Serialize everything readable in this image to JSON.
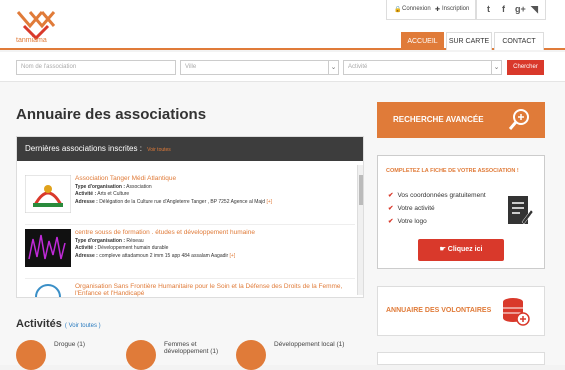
{
  "brand": {
    "logo_text": "tanmiama",
    "accent": "#e07b39",
    "red": "#d9392b"
  },
  "header": {
    "login": "Connexion",
    "signup": "Inscription",
    "social": [
      "twitter-icon",
      "facebook-icon",
      "google-plus-icon",
      "rss-icon"
    ],
    "social_glyphs": [
      "t",
      "f",
      "g+",
      "◥"
    ],
    "nav": [
      "ACCUEIL",
      "SUR CARTE",
      "CONTACT"
    ]
  },
  "search": {
    "name_placeholder": "Nom de l'association",
    "city_placeholder": "Ville",
    "activity_placeholder": "Activité",
    "button": "Chercher"
  },
  "main": {
    "title": "Annuaire des associations",
    "latest_title": "Dernières associations inscrites :",
    "latest_more": "Voir toutes",
    "associations": [
      {
        "name": "Association Tanger Médi Atlantique",
        "type_label": "Type d'organisation :",
        "type": "Association",
        "activity_label": "Activité :",
        "activity": "Arts et Culture",
        "address_label": "Adresse :",
        "address": "Délégation de la Culture rue d'Angleterre Tanger , BP 7252 Agence al Majd",
        "plus": "[+]"
      },
      {
        "name": "centre souss de formation . études et développement humaine",
        "type_label": "Type d'organisation :",
        "type": "Réseau",
        "activity_label": "Activité :",
        "activity": "Développement humain durable",
        "address_label": "Adresse :",
        "address": "compleve attadamoun 2 imm 15 app 484 assalam Aagadir",
        "plus": "[+]"
      },
      {
        "name": "Organisation Sans Frontière Humanitaire pour le Soin et la Défense des Droits de la Femme, l'Enfance et l'Handicapé"
      }
    ],
    "activities_title": "Activités",
    "activities_link": "( Voir toutes )",
    "activities": [
      {
        "label": "Drogue (1)"
      },
      {
        "label": "Femmes et développement (1)"
      },
      {
        "label": "Développement local (1)"
      }
    ]
  },
  "sidebar": {
    "advanced_search": "RECHERCHE AVANCÉE",
    "complete_title": "COMPLETEZ LA FICHE DE VOTRE ASSOCIATION !",
    "complete_items": [
      "Vos coordonnées gratuitement",
      "Votre activité",
      "Votre logo"
    ],
    "click_here": "Cliquez ici",
    "volunteers": "ANNUAIRE DES VOLONTAIRES"
  }
}
